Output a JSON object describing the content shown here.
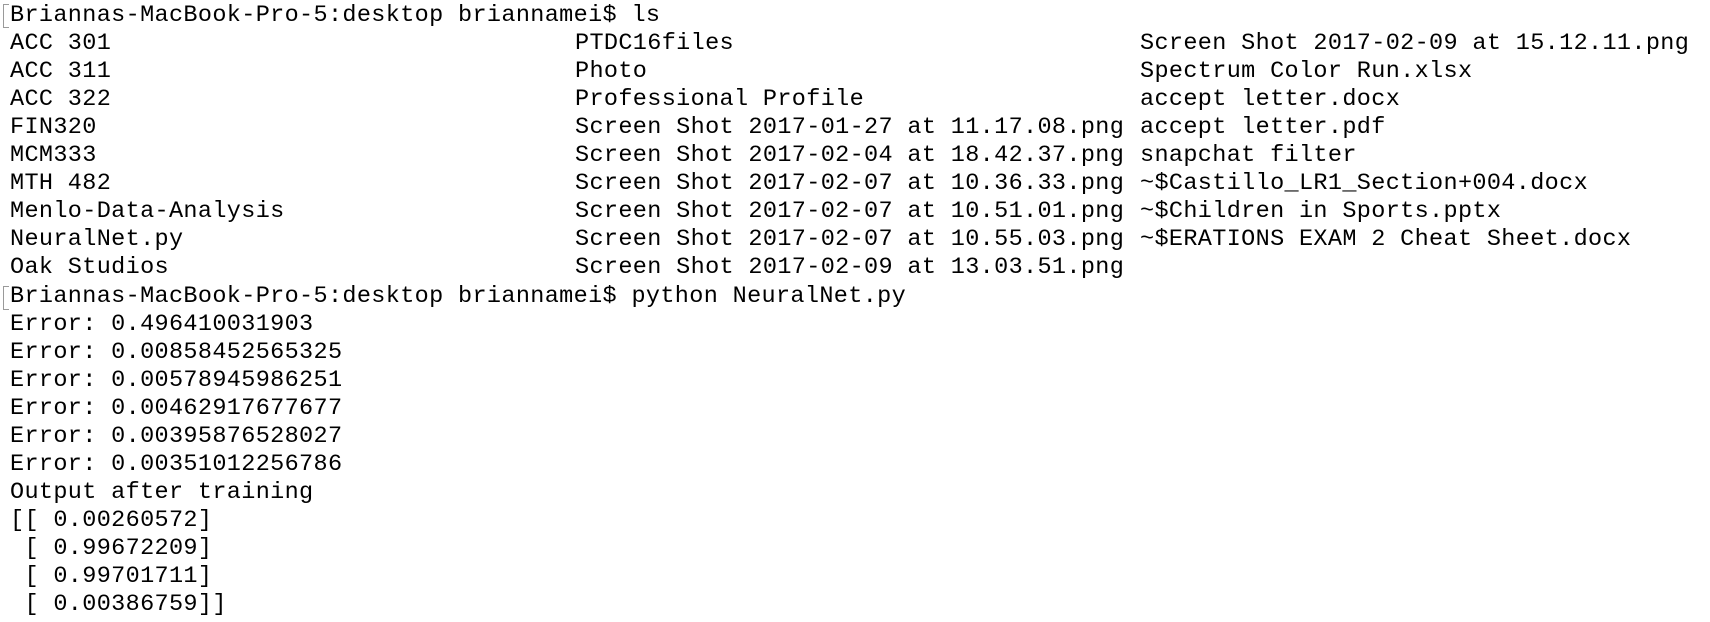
{
  "session": {
    "prompt": "Briannas-MacBook-Pro-5:desktop briannamei$",
    "commands": [
      "ls",
      "python NeuralNet.py"
    ]
  },
  "ls_output": {
    "col1": [
      "ACC 301",
      "ACC 311",
      "ACC 322",
      "FIN320",
      "MCM333",
      "MTH 482",
      "Menlo-Data-Analysis",
      "NeuralNet.py",
      "Oak Studios"
    ],
    "col2": [
      "PTDC16files",
      "Photo",
      "Professional Profile",
      "Screen Shot 2017-01-27 at 11.17.08.png",
      "Screen Shot 2017-02-04 at 18.42.37.png",
      "Screen Shot 2017-02-07 at 10.36.33.png",
      "Screen Shot 2017-02-07 at 10.51.01.png",
      "Screen Shot 2017-02-07 at 10.55.03.png",
      "Screen Shot 2017-02-09 at 13.03.51.png"
    ],
    "col3": [
      "Screen Shot 2017-02-09 at 15.12.11.png",
      "Spectrum Color Run.xlsx",
      "accept letter.docx",
      "accept letter.pdf",
      "snapchat filter",
      "~$Castillo_LR1_Section+004.docx",
      "~$Children in Sports.pptx",
      "~$ERATIONS EXAM 2 Cheat Sheet.docx"
    ]
  },
  "python_output": [
    "Error: 0.496410031903",
    "Error: 0.00858452565325",
    "Error: 0.00578945986251",
    "Error: 0.00462917677677",
    "Error: 0.00395876528027",
    "Error: 0.00351012256786",
    "Output after training",
    "[[ 0.00260572]",
    " [ 0.99672209]",
    " [ 0.99701711]",
    " [ 0.00386759]]"
  ],
  "colors": {
    "background": "#ffffff",
    "text": "#000000",
    "mark": "#9a9a9a"
  }
}
